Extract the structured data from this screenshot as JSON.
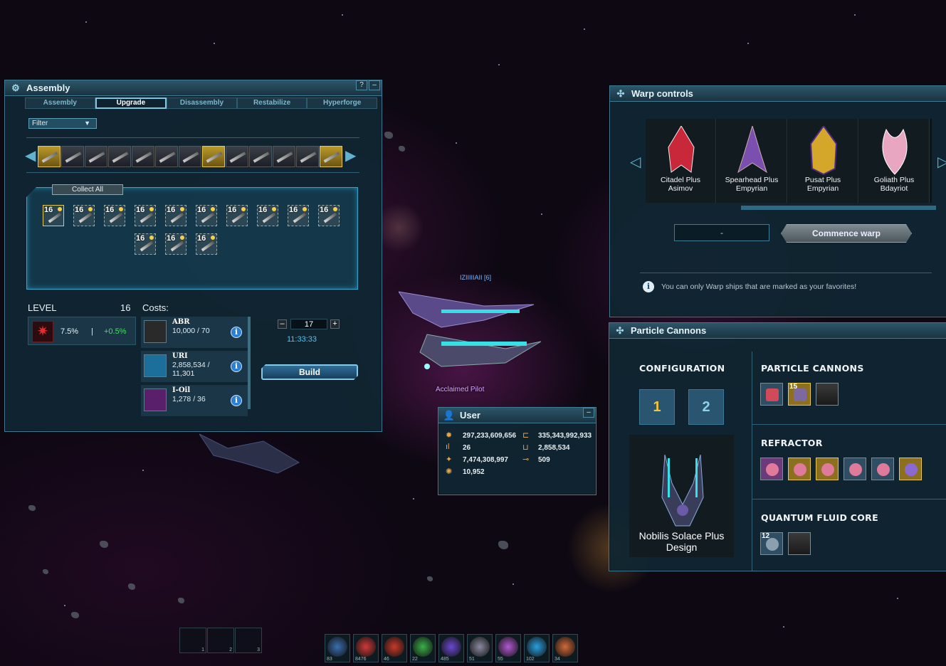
{
  "assembly": {
    "title": "Assembly",
    "help_label": "?",
    "minimize_label": "–",
    "tabs": [
      {
        "label": "Assembly",
        "active": false
      },
      {
        "label": "Upgrade",
        "active": true
      },
      {
        "label": "Disassembly",
        "active": false
      },
      {
        "label": "Restabilize",
        "active": false
      },
      {
        "label": "Hyperforge",
        "active": false
      }
    ],
    "filter_label": "Filter",
    "collect_all_label": "Collect All",
    "cells": [
      "16",
      "16",
      "16",
      "16",
      "16",
      "16",
      "16",
      "16",
      "16",
      "16",
      "16",
      "16",
      "16"
    ],
    "level_label": "LEVEL",
    "level_value": "16",
    "level_pct": "7.5%",
    "level_sep": "|",
    "level_bonus": "+0.5%",
    "costs_label": "Costs:",
    "costs": [
      {
        "name": "ABR",
        "amount": "10,000 / 70",
        "icon": "abr-icon"
      },
      {
        "name": "URI",
        "amount": "2,858,534 / 11,301",
        "icon": "uri-icon"
      },
      {
        "name": "I-Oil",
        "amount": "1,278 / 36",
        "icon": "ioil-icon"
      }
    ],
    "quantity": "17",
    "minus_label": "–",
    "plus_label": "+",
    "timer": "11:33:33",
    "build_label": "Build"
  },
  "warp": {
    "title": "Warp controls",
    "ships": [
      {
        "name": "Citadel Plus",
        "design": "Asimov",
        "color": "#c8283a"
      },
      {
        "name": "Spearhead Plus",
        "design": "Empyrian",
        "color": "#7a4fb0"
      },
      {
        "name": "Pusat Plus",
        "design": "Empyrian",
        "color": "#d4a72a"
      },
      {
        "name": "Goliath Plus",
        "design": "Bdayriot",
        "color": "#e8a6c0"
      }
    ],
    "destination_value": "-",
    "commence_label": "Commence warp",
    "note": "You can only Warp ships that are marked as your favorites!",
    "info_label": "i"
  },
  "cannons": {
    "title": "Particle Cannons",
    "configuration_label": "CONFIGURATION",
    "config_buttons": [
      "1",
      "2"
    ],
    "ship_name": "Nobilis Solace Plus",
    "ship_design": "Design",
    "particle_cannons_label": "PARTICLE CANNONS",
    "particle_slots": [
      {
        "count": "",
        "style": "blue"
      },
      {
        "count": "15",
        "style": "gold"
      },
      {
        "count": "",
        "style": "empty"
      }
    ],
    "refractor_label": "REFRACTOR",
    "refractor_slots": [
      "pink",
      "gold",
      "gold",
      "blue",
      "blue",
      "purple"
    ],
    "quantum_label": "QUANTUM FLUID CORE",
    "quantum_slots": [
      {
        "count": "12",
        "style": "blue"
      },
      {
        "count": "",
        "style": "empty"
      }
    ]
  },
  "user": {
    "title": "User",
    "minimize_label": "–",
    "stats": {
      "credits": "297,233,609,656",
      "uridium": "335,343,992,933",
      "level": "26",
      "uri_small": "2,858,534",
      "experience": "7,474,308,997",
      "keys": "509",
      "honor": "10,952"
    }
  },
  "world": {
    "pilot_title": "Acclaimed Pilot",
    "player_name": "IZIIIIIAII [6]"
  },
  "hotbar": {
    "slots": [
      {
        "n": "83",
        "color": "#3a6fb0"
      },
      {
        "n": "8476",
        "color": "#d03a3a"
      },
      {
        "n": "46",
        "color": "#c83a2a"
      },
      {
        "n": "22",
        "color": "#3ab04a"
      },
      {
        "n": "485",
        "color": "#6a4ad0"
      },
      {
        "n": "51",
        "color": "#8a8aa0"
      },
      {
        "n": "55",
        "color": "#b05ad0"
      },
      {
        "n": "102",
        "color": "#2aa0e0"
      },
      {
        "n": "34",
        "color": "#d06a3a"
      }
    ],
    "grid_numbers": [
      "1",
      "2",
      "3"
    ]
  }
}
